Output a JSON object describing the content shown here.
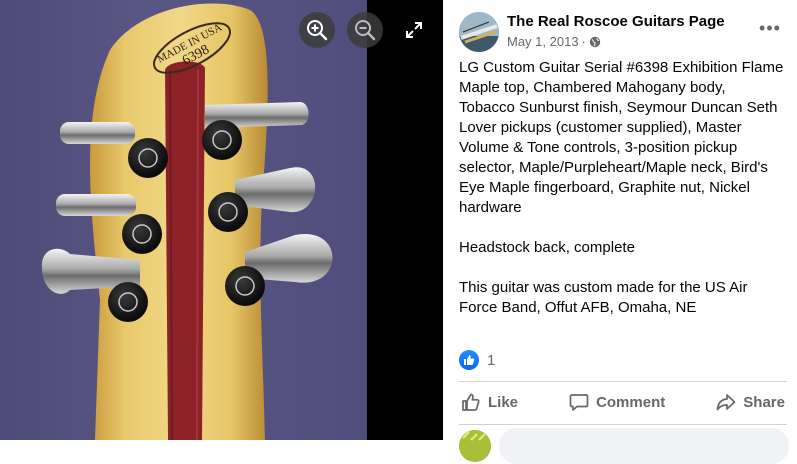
{
  "viewer": {
    "photo": {
      "stamp_line1": "MADE IN USA",
      "stamp_line2": "6398"
    },
    "icons": [
      "zoom-in-icon",
      "zoom-out-icon",
      "fullscreen-icon"
    ]
  },
  "post": {
    "page_name": "The Real Roscoe Guitars Page",
    "date": "May 1, 2013",
    "separator": "·",
    "audience_icon": "globe-icon",
    "more_label": "•••",
    "caption": [
      "LG Custom Guitar Serial #6398 Exhibition Flame Maple top, Chambered Mahogany body, Tobacco Sunburst finish, Seymour Duncan Seth Lover pickups (customer supplied), Master Volume & Tone controls, 3-position pickup selector, Maple/Purpleheart/Maple neck, Bird's Eye Maple fingerboard, Graphite nut, Nickel hardware",
      "Headstock back, complete",
      "This guitar was custom made for the US Air Force Band, Offut AFB, Omaha, NE"
    ],
    "reactions": {
      "icon": "like-reaction-icon",
      "count": "1"
    },
    "actions": {
      "like": "Like",
      "comment": "Comment",
      "share": "Share"
    }
  },
  "colors": {
    "accent": "#0866ff",
    "text": "#050505",
    "secondary_text": "#65676b",
    "divider": "#ced0d4",
    "photo_background": "#58558a",
    "wood": "#e3c262",
    "purpleheart": "#8b2228"
  }
}
